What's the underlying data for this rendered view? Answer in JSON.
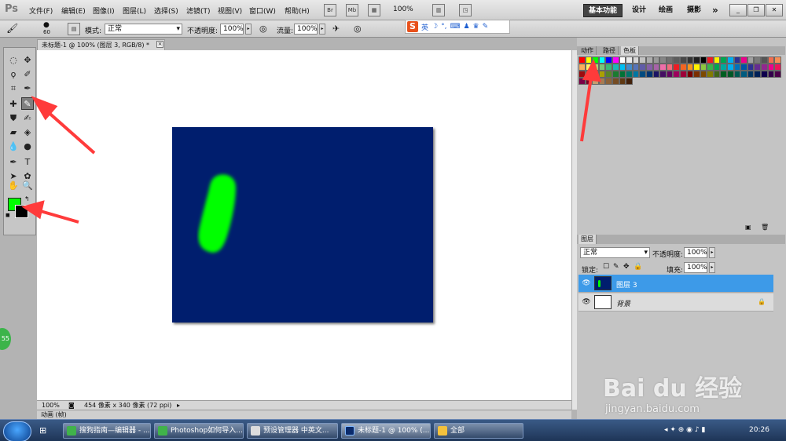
{
  "menubar": {
    "logo": "Ps",
    "items": [
      "文件(F)",
      "编辑(E)",
      "图像(I)",
      "图层(L)",
      "选择(S)",
      "滤镜(T)",
      "视图(V)",
      "窗口(W)",
      "帮助(H)"
    ],
    "icons": [
      "Br",
      "Mb"
    ],
    "zoom": "100%",
    "workspaces": [
      "基本功能",
      "设计",
      "绘画",
      "摄影"
    ],
    "more": "»"
  },
  "options": {
    "brush_size": "60",
    "mode_label": "模式:",
    "mode_value": "正常",
    "opacity_label": "不透明度:",
    "opacity_value": "100%",
    "flow_label": "流量:",
    "flow_value": "100%"
  },
  "ime": {
    "brand": "S",
    "lang": "英"
  },
  "document": {
    "tab_title": "未标题-1 @ 100% (图层 3, RGB/8) *",
    "zoom": "100%",
    "size_info": "454 像素 x 340 像素 (72 ppi)",
    "animation_label": "动画 (帧)",
    "canvas_color": "#001e6e",
    "stroke_color": "#00ff00"
  },
  "colors": {
    "foreground": "#00ff00",
    "background": "#000000"
  },
  "swatches_panel": {
    "tabs": [
      "动作",
      "路径",
      "色板"
    ],
    "colors": [
      "#ff0000",
      "#ffff00",
      "#00ff00",
      "#00ffff",
      "#0000ff",
      "#ff00ff",
      "#ffffff",
      "#ebebeb",
      "#d6d6d6",
      "#c2c2c2",
      "#adadad",
      "#999999",
      "#858585",
      "#707070",
      "#5c5c5c",
      "#474747",
      "#333333",
      "#1f1f1f",
      "#000000",
      "#ed1c24",
      "#fff200",
      "#00a651",
      "#00aeef",
      "#2e3192",
      "#ec008c",
      "#a0a0a0",
      "#7a7a7a",
      "#555555",
      "#f26c4f",
      "#f68e55",
      "#fbaf5c",
      "#fff467",
      "#acd372",
      "#7cc576",
      "#3bb878",
      "#1abbb4",
      "#00bff3",
      "#438ccb",
      "#5574b9",
      "#605ca8",
      "#855fa8",
      "#a763a8",
      "#f06ea9",
      "#f26d7d",
      "#ed1c24",
      "#f26522",
      "#f7941d",
      "#fff200",
      "#8dc63f",
      "#39b54a",
      "#00a651",
      "#00a99d",
      "#00aeef",
      "#0072bc",
      "#0054a6",
      "#2e3192",
      "#662d91",
      "#92278f",
      "#ec008c",
      "#ed145b",
      "#9e0b0f",
      "#a0410d",
      "#a36209",
      "#aba000",
      "#598527",
      "#1a7b30",
      "#007236",
      "#00746b",
      "#0076a3",
      "#004b80",
      "#003471",
      "#1b1464",
      "#440e62",
      "#630460",
      "#9e005d",
      "#9e0039",
      "#790000",
      "#7b2e00",
      "#7d4900",
      "#827b00",
      "#406618",
      "#005e20",
      "#005826",
      "#005952",
      "#005b7f",
      "#003663",
      "#002157",
      "#0d004c",
      "#32004b",
      "#4b0049",
      "#7b0046",
      "#7a0026",
      "#c69c6d",
      "#a67c52",
      "#8c6239",
      "#754c24",
      "#603913",
      "#42210b"
    ]
  },
  "layers_panel": {
    "tab": "图层",
    "blend_mode": "正常",
    "opacity_label": "不透明度:",
    "opacity_value": "100%",
    "lock_label": "锁定:",
    "fill_label": "填充:",
    "fill_value": "100%",
    "layers": [
      {
        "name": "图层 3",
        "selected": true
      },
      {
        "name": "背景",
        "selected": false
      }
    ]
  },
  "taskbar": {
    "tasks": [
      "搜狗指南—编辑器 - ...",
      "Photoshop如何导入...",
      "预设管理器 中英文...",
      "未标题-1 @ 100% (...",
      "全部"
    ],
    "clock": "20:26"
  },
  "watermark": {
    "text": "Bai du 经验",
    "url": "jingyan.baidu.com"
  },
  "badge": "55"
}
